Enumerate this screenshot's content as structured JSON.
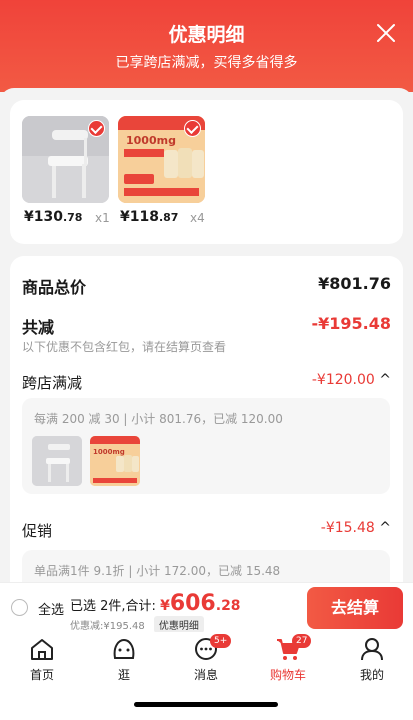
{
  "header": {
    "title": "优惠明细",
    "subtitle": "已享跨店满减，买得多省得多"
  },
  "products": [
    {
      "price_int": "¥130",
      "price_dec": ".78",
      "qty": "x1",
      "icon": "chair-image"
    },
    {
      "price_int": "¥118",
      "price_dec": ".87",
      "qty": "x4",
      "icon": "supplement-image",
      "thumb_text": "1000mg"
    }
  ],
  "summary": {
    "total_label": "商品总价",
    "total_value": "¥801.76",
    "discount_label": "共减",
    "discount_value": "-¥195.48",
    "discount_note": "以下优惠不包含红包，请在结算页查看"
  },
  "cross_store": {
    "label": "跨店满减",
    "value": "-¥120.00",
    "detail": "每满 200 减 30 | 小计 801.76，已减 120.00",
    "mini_text": "1000mg"
  },
  "promotion": {
    "label": "促销",
    "value": "-¥15.48",
    "detail": "单品满1件 9.1折 | 小计 172.00，已减 15.48"
  },
  "bottom_bar": {
    "select_all": "全选",
    "selected": "已选 2件,合计:",
    "currency": "¥",
    "total_int": "606",
    "total_dec": ".28",
    "discount_line": "优惠减:¥195.48",
    "detail_btn": "优惠明细",
    "checkout": "去结算"
  },
  "tabs": [
    {
      "label": "首页",
      "icon": "home-icon"
    },
    {
      "label": "逛",
      "icon": "browse-icon"
    },
    {
      "label": "消息",
      "icon": "message-icon",
      "badge": "5+"
    },
    {
      "label": "购物车",
      "icon": "cart-icon",
      "badge": "27",
      "active": true
    },
    {
      "label": "我的",
      "icon": "profile-icon"
    }
  ],
  "colors": {
    "accent": "#e93a36"
  }
}
